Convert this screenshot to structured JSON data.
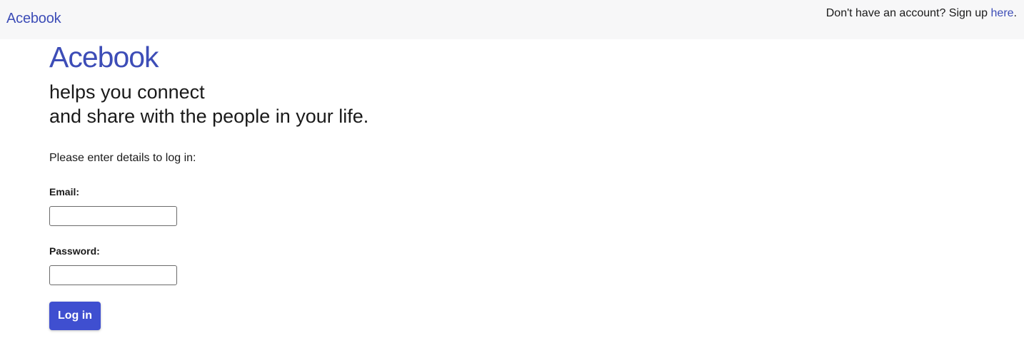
{
  "navbar": {
    "brand": "Acebook",
    "signup_prompt": "Don't have an account? Sign up ",
    "signup_link": "here",
    "signup_end": "."
  },
  "hero": {
    "title": "Acebook",
    "tagline_line1": "helps you connect",
    "tagline_line2": "and share with the people in your life."
  },
  "login_form": {
    "intro": "Please enter details to log in:",
    "email_label": "Email:",
    "email_value": "",
    "password_label": "Password:",
    "password_value": "",
    "submit_label": "Log in"
  },
  "colors": {
    "brand": "#3d4db7",
    "button": "#3f4fd0",
    "navbar_bg": "#f7f7f8"
  }
}
